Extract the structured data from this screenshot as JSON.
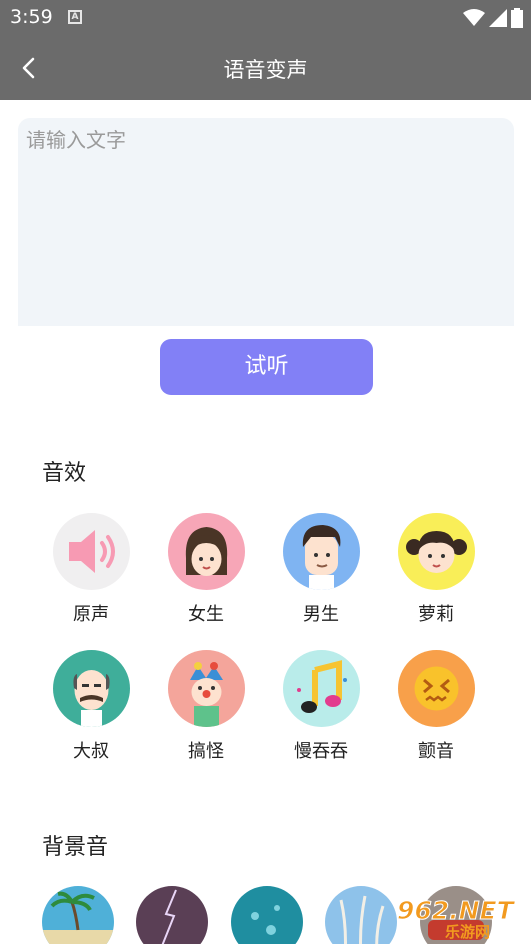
{
  "status": {
    "time": "3:59",
    "notif_icon": "A"
  },
  "appbar": {
    "title": "语音变声",
    "back_icon": "chevron-left-icon"
  },
  "input": {
    "placeholder": "请输入文字",
    "value": ""
  },
  "listen_button": {
    "label": "试听",
    "color": "#8280f6"
  },
  "effects": {
    "title": "音效",
    "items": [
      {
        "label": "原声",
        "icon": "speaker-icon",
        "bg": "#f0eff0"
      },
      {
        "label": "女生",
        "icon": "girl-avatar-icon",
        "bg": "#f7a6b7"
      },
      {
        "label": "男生",
        "icon": "boy-avatar-icon",
        "bg": "#7fb4f2"
      },
      {
        "label": "萝莉",
        "icon": "loli-avatar-icon",
        "bg": "#f9ee58"
      },
      {
        "label": "大叔",
        "icon": "uncle-avatar-icon",
        "bg": "#3fae9a"
      },
      {
        "label": "搞怪",
        "icon": "clown-avatar-icon",
        "bg": "#f4a59b"
      },
      {
        "label": "慢吞吞",
        "icon": "music-note-icon",
        "bg": "#b9ecea"
      },
      {
        "label": "颤音",
        "icon": "dizzy-face-icon",
        "bg": "#f8a04a"
      }
    ]
  },
  "background_sounds": {
    "title": "背景音",
    "items": [
      {
        "icon": "beach-thumb",
        "color": "#4fb0d8"
      },
      {
        "icon": "lightning-thumb",
        "color": "#5a3f55"
      },
      {
        "icon": "rain-thumb",
        "color": "#1f8ea0"
      },
      {
        "icon": "reeds-thumb",
        "color": "#8ec2ea"
      },
      {
        "icon": "vehicle-thumb",
        "color": "#9a8f88"
      }
    ]
  },
  "watermark": {
    "text": "962.NET",
    "subtext": "乐游网"
  }
}
